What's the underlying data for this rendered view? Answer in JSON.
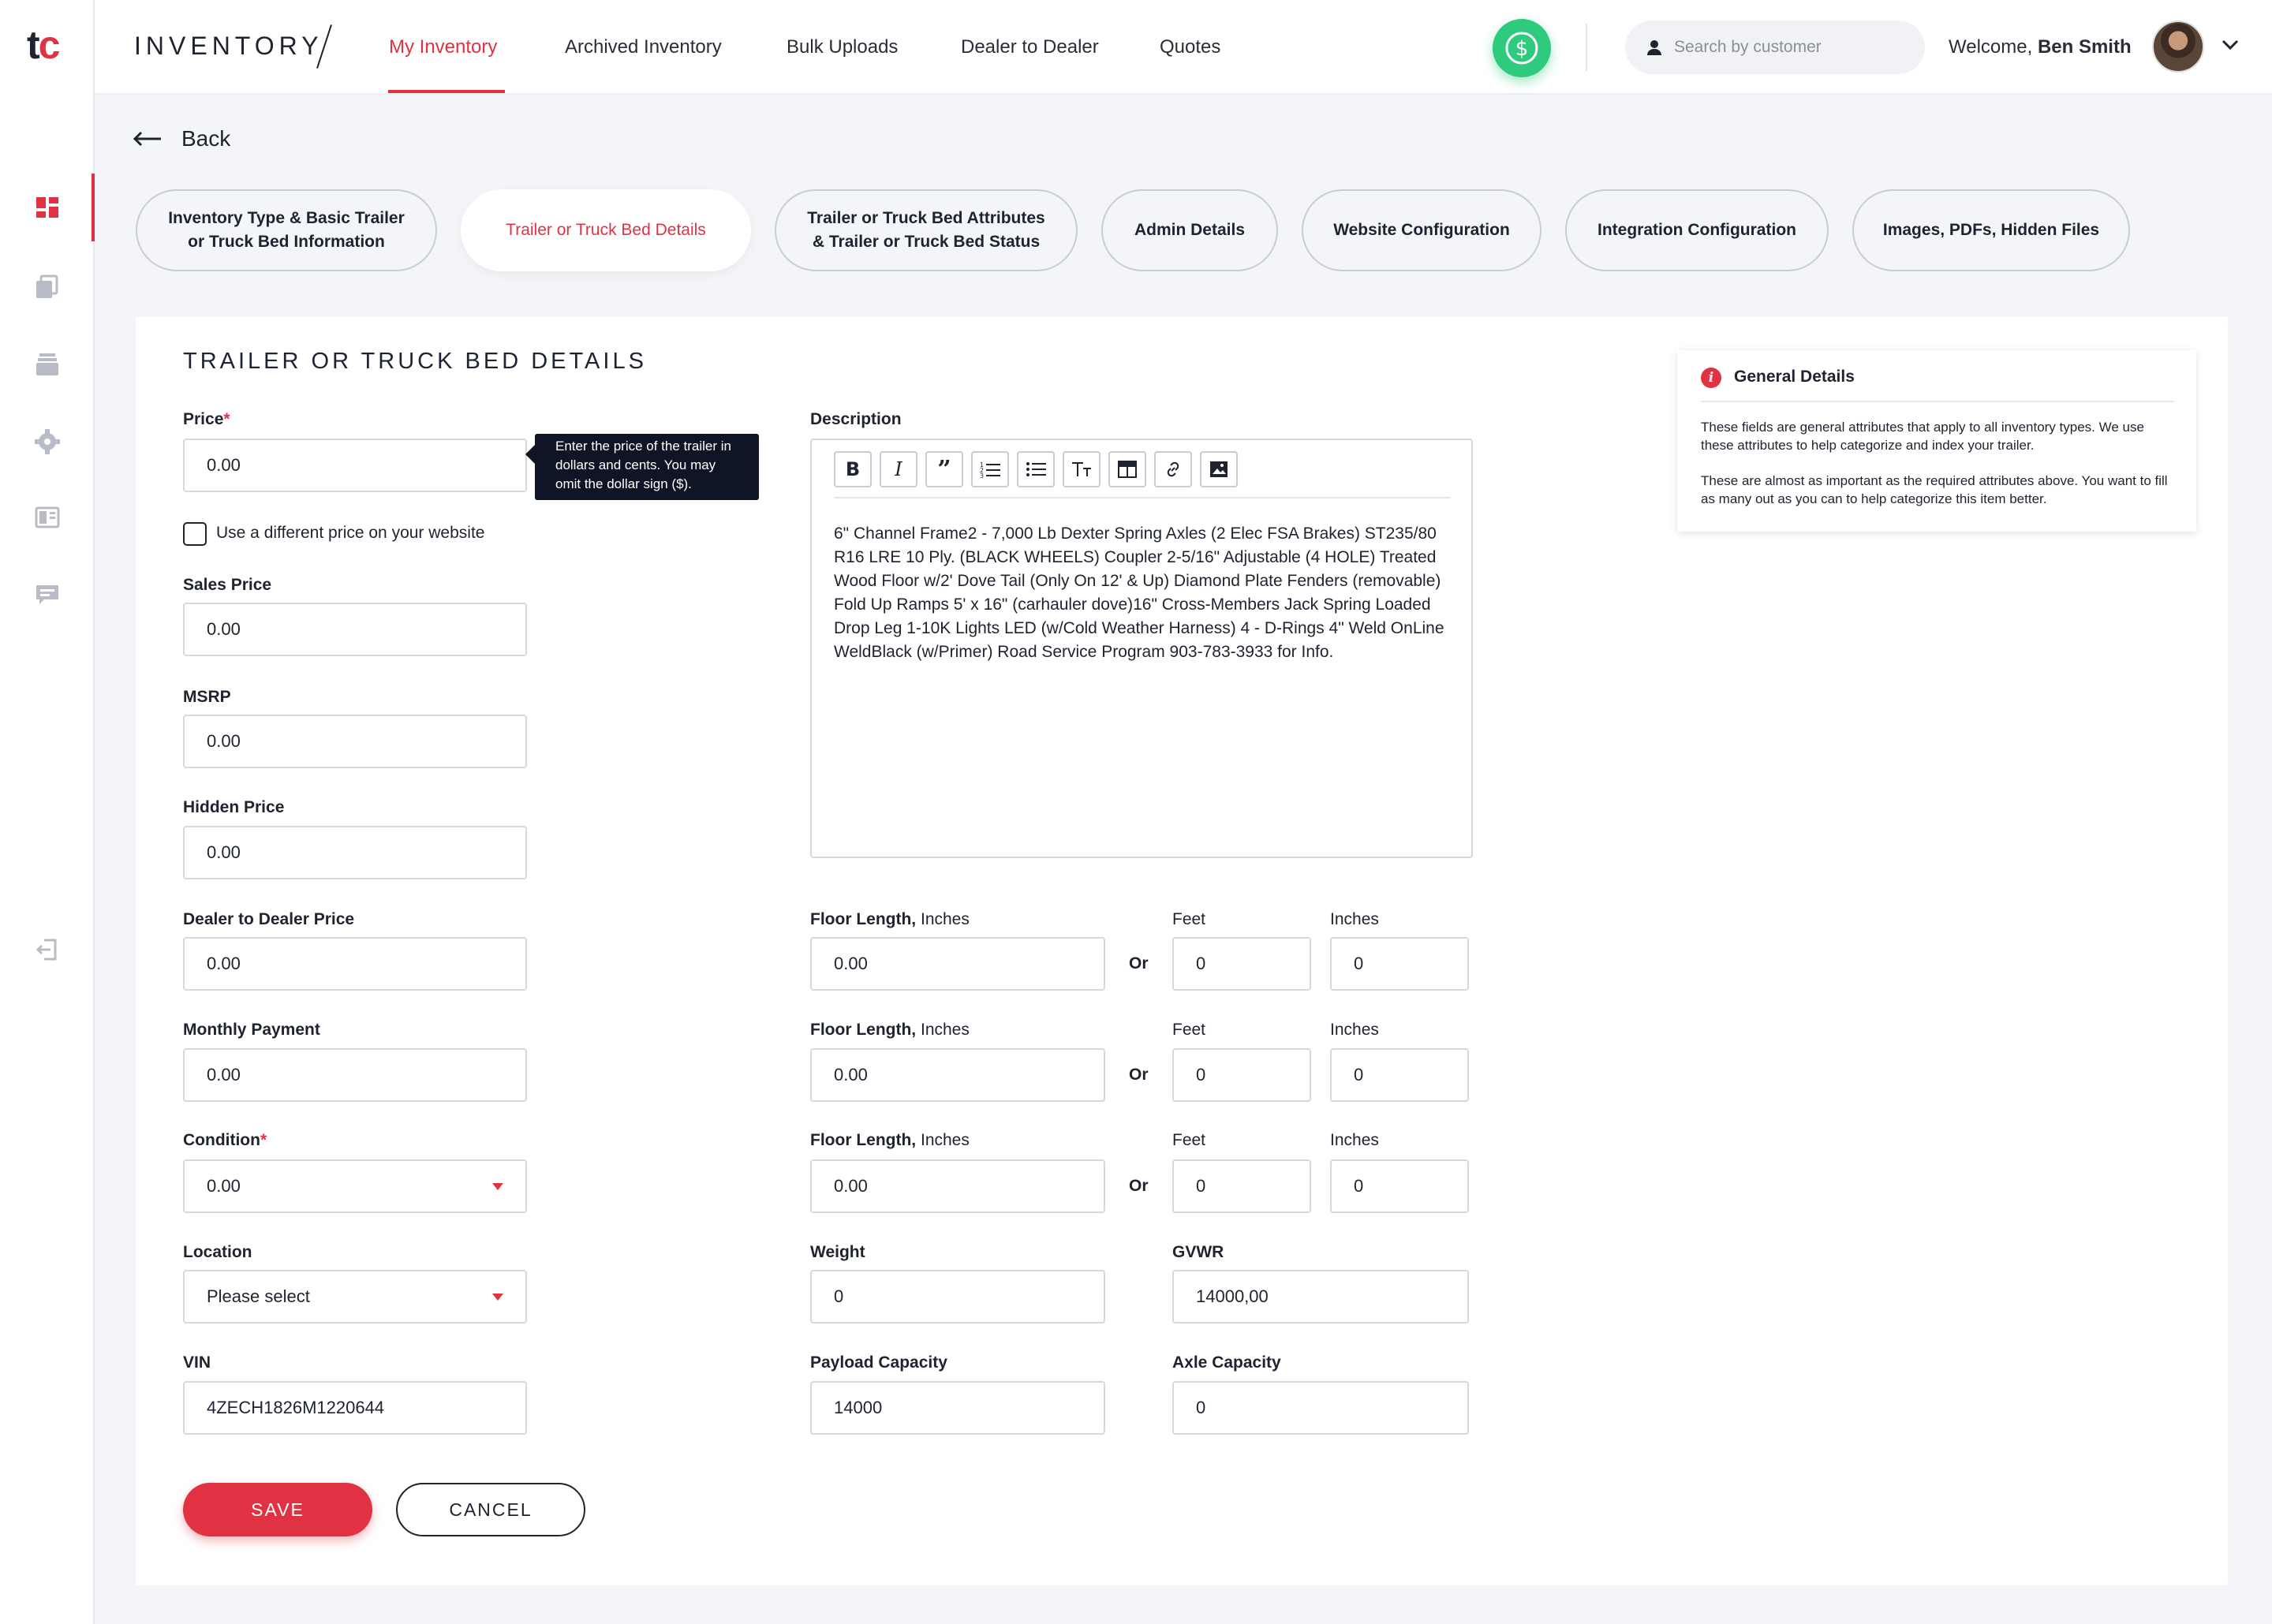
{
  "logo": {
    "t": "t",
    "c": "c"
  },
  "header": {
    "brand": "INVENTORY",
    "nav": [
      "My Inventory",
      "Archived Inventory",
      "Bulk Uploads",
      "Dealer to Dealer",
      "Quotes"
    ],
    "search_placeholder": "Search by customer",
    "welcome_prefix": "Welcome,",
    "user_name": "Ben Smith"
  },
  "back_label": "Back",
  "tabs": [
    {
      "line1": "Inventory Type & Basic Trailer",
      "line2": "or Truck Bed Information"
    },
    {
      "line1": "Trailer or Truck Bed Details",
      "line2": ""
    },
    {
      "line1": "Trailer or Truck Bed Attributes",
      "line2": "& Trailer or Truck Bed Status"
    },
    {
      "line1": "Admin Details",
      "line2": ""
    },
    {
      "line1": "Website Configuration",
      "line2": ""
    },
    {
      "line1": "Integration Configuration",
      "line2": ""
    },
    {
      "line1": "Images, PDFs, Hidden Files",
      "line2": ""
    }
  ],
  "section_title": "TRAILER OR TRUCK BED DETAILS",
  "form": {
    "price": {
      "label": "Price",
      "value": "0.00"
    },
    "price_tooltip": "Enter the price of the trailer in dollars and cents. You may omit the dollar sign ($).",
    "different_price_label": "Use a different price on your website",
    "sales_price": {
      "label": "Sales Price",
      "value": "0.00"
    },
    "msrp": {
      "label": "MSRP",
      "value": "0.00"
    },
    "hidden_price": {
      "label": "Hidden Price",
      "value": "0.00"
    },
    "dealer_price": {
      "label": "Dealer to Dealer Price",
      "value": "0.00"
    },
    "monthly_payment": {
      "label": "Monthly Payment",
      "value": "0.00"
    },
    "condition": {
      "label": "Condition",
      "value": "0.00"
    },
    "location": {
      "label": "Location",
      "value": "Please select"
    },
    "vin": {
      "label": "VIN",
      "value": "4ZECH1826M1220644"
    },
    "description": {
      "label": "Description",
      "text": "6\" Channel Frame2 - 7,000 Lb Dexter Spring Axles (2 Elec FSA Brakes) ST235/80 R16 LRE 10 Ply. (BLACK WHEELS) Coupler 2-5/16\" Adjustable (4 HOLE) Treated Wood Floor w/2' Dove Tail (Only On 12' & Up) Diamond Plate Fenders (removable) Fold Up Ramps 5' x 16\" (carhauler dove)16\" Cross-Members Jack Spring Loaded Drop Leg 1-10K Lights LED (w/Cold Weather Harness) 4 - D-Rings 4\" Weld OnLine WeldBlack (w/Primer) Road Service Program 903-783-3933 for Info."
    },
    "floor_rows": [
      {
        "label_bold": "Floor Length,",
        "label_light": " Inches",
        "inches_total": "0.00",
        "or": "Or",
        "feet_label": "Feet",
        "feet": "0",
        "inches_label": "Inches",
        "inches": "0"
      },
      {
        "label_bold": "Floor Length,",
        "label_light": " Inches",
        "inches_total": "0.00",
        "or": "Or",
        "feet_label": "Feet",
        "feet": "0",
        "inches_label": "Inches",
        "inches": "0"
      },
      {
        "label_bold": "Floor Length,",
        "label_light": " Inches",
        "inches_total": "0.00",
        "or": "Or",
        "feet_label": "Feet",
        "feet": "0",
        "inches_label": "Inches",
        "inches": "0"
      }
    ],
    "weight": {
      "label": "Weight",
      "value": "0"
    },
    "gvwr": {
      "label": "GVWR",
      "value": "14000,00"
    },
    "payload": {
      "label": "Payload Capacity",
      "value": "14000"
    },
    "axle": {
      "label": "Axle Capacity",
      "value": "0"
    },
    "save": "SAVE",
    "cancel": "CANCEL"
  },
  "info": {
    "title": "General Details",
    "p1": "These fields are general attributes that apply to all inventory types. We use these attributes to help categorize and index your trailer.",
    "p2": "These are almost as important as the required attributes above. You want to fill as many out as you can to help categorize this item better."
  },
  "colors": {
    "accent": "#e03242",
    "green": "#2ecb7f",
    "text": "#1f2330"
  }
}
